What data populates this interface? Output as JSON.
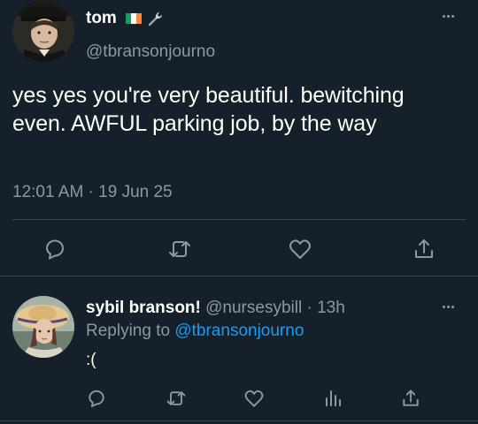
{
  "main_tweet": {
    "display_name": "tom",
    "flag_colors": [
      "#169b62",
      "#ffffff",
      "#ff883e"
    ],
    "badge_icon": "wrench-icon",
    "handle": "@tbransonjourno",
    "text": "yes yes you're very beautiful. bewitching even. AWFUL parking job, by the way",
    "timestamp": "12:01 AM · 19 Jun 25",
    "actions": [
      "reply-icon",
      "retweet-icon",
      "like-icon",
      "share-icon"
    ]
  },
  "reply": {
    "display_name": "sybil branson!",
    "handle": "@nursesybill",
    "separator": " · ",
    "time": "13h",
    "replying_prefix": "Replying to ",
    "replying_to": "@tbransonjourno",
    "text": ":(",
    "actions": [
      "reply-icon",
      "retweet-icon",
      "like-icon",
      "analytics-icon",
      "share-icon"
    ]
  },
  "colors": {
    "background": "#15202b",
    "secondary_text": "#8b98a5",
    "link": "#1d9bf0",
    "divider": "#38444d"
  }
}
